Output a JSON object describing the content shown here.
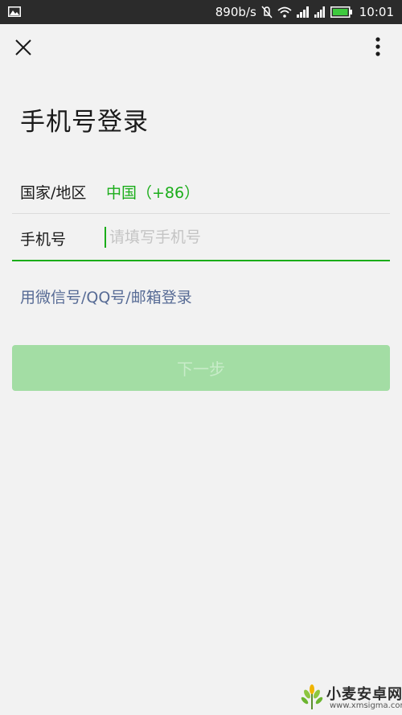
{
  "status_bar": {
    "net_speed": "890b/s",
    "time": "10:01",
    "icons": [
      "gallery-icon",
      "mute-icon",
      "wifi-icon",
      "signal-icon",
      "signal-icon",
      "battery-icon"
    ]
  },
  "toolbar": {
    "close_icon": "close-icon",
    "more_icon": "more-vertical-icon"
  },
  "page": {
    "title": "手机号登录"
  },
  "form": {
    "country_label": "国家/地区",
    "country_value": "中国（+86）",
    "phone_label": "手机号",
    "phone_value": "",
    "phone_placeholder": "请填写手机号"
  },
  "alt_login": "用微信号/QQ号/邮箱登录",
  "next_button": "下一步",
  "watermark": {
    "name": "小麦安卓网",
    "url": "www.xmsigma.com"
  },
  "colors": {
    "accent": "#1aad19",
    "link": "#576b95",
    "button_disabled": "#a3dda4",
    "background": "#f2f2f2"
  }
}
